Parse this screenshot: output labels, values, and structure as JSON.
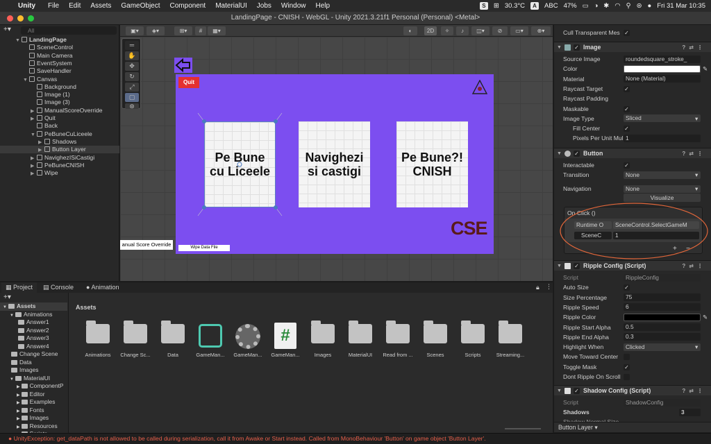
{
  "menubar": {
    "app": "Unity",
    "items": [
      "File",
      "Edit",
      "Assets",
      "GameObject",
      "Component",
      "MaterialUI",
      "Jobs",
      "Window",
      "Help"
    ],
    "temp": "30.3°C",
    "input": "ABC",
    "battery": "47%",
    "datetime": "Fri 31 Mar  10:35"
  },
  "window": {
    "title": "LandingPage - CNISH - WebGL - Unity 2021.3.21f1 Personal (Personal) <Metal>"
  },
  "hierarchy": {
    "search_placeholder": "All",
    "items": [
      {
        "label": "LandingPage",
        "level": 0
      },
      {
        "label": "SceneControl",
        "level": 1
      },
      {
        "label": "Main Camera",
        "level": 1
      },
      {
        "label": "EventSystem",
        "level": 1
      },
      {
        "label": "SaveHandler",
        "level": 1
      },
      {
        "label": "Canvas",
        "level": 1
      },
      {
        "label": "Background",
        "level": 2
      },
      {
        "label": "Image (1)",
        "level": 2
      },
      {
        "label": "Image (3)",
        "level": 2
      },
      {
        "label": "ManualScoreOverride",
        "level": 2
      },
      {
        "label": "Quit",
        "level": 2
      },
      {
        "label": "Back",
        "level": 2
      },
      {
        "label": "PeBuneCuLiceele",
        "level": 2
      },
      {
        "label": "Shadows",
        "level": 3
      },
      {
        "label": "Button Layer",
        "level": 3
      },
      {
        "label": "NavighezISiCastigi",
        "level": 2
      },
      {
        "label": "PeBuneCNISH",
        "level": 2
      },
      {
        "label": "Wipe",
        "level": 2
      }
    ]
  },
  "scene": {
    "mode_2d": "2D",
    "quit_label": "Quit",
    "cards": [
      "Pe Bune\ncu Liceele",
      "Navighezi\nsi castigi",
      "Pe Bune?!\nCNISH"
    ],
    "wipe_label": "Wipe Data File",
    "manual_label": "anual Score Override",
    "logo_text": "CSE"
  },
  "inspector": {
    "cull": "Cull Transparent Mes",
    "image_header": "Image",
    "image_fields": [
      {
        "label": "Source Image",
        "value": "roundedsquare_stroke_"
      },
      {
        "label": "Color",
        "value": ""
      },
      {
        "label": "Material",
        "value": "None (Material)"
      },
      {
        "label": "Raycast Target",
        "value": "✓"
      },
      {
        "label": "Raycast Padding",
        "value": ""
      },
      {
        "label": "Maskable",
        "value": "✓"
      },
      {
        "label": "Image Type",
        "value": "Sliced"
      },
      {
        "label": "Fill Center",
        "value": "✓"
      },
      {
        "label": "Pixels Per Unit Mul",
        "value": "1"
      }
    ],
    "button_header": "Button",
    "button_fields": [
      {
        "label": "Interactable",
        "value": "✓"
      },
      {
        "label": "Transition",
        "value": "None"
      },
      {
        "label": "Navigation",
        "value": "None"
      }
    ],
    "visualize": "Visualize",
    "onclick_title": "On Click ()",
    "onclick_runtime": "Runtime O",
    "onclick_method": "SceneControl.SelectGameM",
    "onclick_obj": "SceneC",
    "onclick_arg": "1",
    "ripple_header": "Ripple Config (Script)",
    "ripple_fields": [
      {
        "label": "Script",
        "value": "RippleConfig"
      },
      {
        "label": "Auto Size",
        "value": "✓"
      },
      {
        "label": "Size Percentage",
        "value": "75"
      },
      {
        "label": "Ripple Speed",
        "value": "6"
      },
      {
        "label": "Ripple Color",
        "value": ""
      },
      {
        "label": "Ripple Start Alpha",
        "value": "0.5"
      },
      {
        "label": "Ripple End Alpha",
        "value": "0.3"
      },
      {
        "label": "Highlight When",
        "value": "Clicked"
      },
      {
        "label": "Move Toward Center",
        "value": ""
      },
      {
        "label": "Toggle Mask",
        "value": "✓"
      },
      {
        "label": "Dont Ripple On Scroll",
        "value": ""
      }
    ],
    "shadow_header": "Shadow Config (Script)",
    "shadow_script": "ShadowConfig",
    "shadows_label": "Shadows",
    "shadows_value": "3",
    "shadow_normal": "Shadow Normal Size",
    "footer": "Button Layer"
  },
  "project": {
    "tabs": [
      "Project",
      "Console",
      "Animation"
    ],
    "breadcrumb": "Assets",
    "badge": "8",
    "tree": [
      {
        "label": "Assets",
        "level": 0
      },
      {
        "label": "Animations",
        "level": 1
      },
      {
        "label": "Answer1",
        "level": 2
      },
      {
        "label": "Answer2",
        "level": 2
      },
      {
        "label": "Answer3",
        "level": 2
      },
      {
        "label": "Answer4",
        "level": 2
      },
      {
        "label": "Change Scene",
        "level": 1
      },
      {
        "label": "Data",
        "level": 1
      },
      {
        "label": "Images",
        "level": 1
      },
      {
        "label": "MaterialUI",
        "level": 1
      },
      {
        "label": "ComponentP",
        "level": 2
      },
      {
        "label": "Editor",
        "level": 2
      },
      {
        "label": "Examples",
        "level": 2
      },
      {
        "label": "Fonts",
        "level": 2
      },
      {
        "label": "Images",
        "level": 2
      },
      {
        "label": "Resources",
        "level": 2
      },
      {
        "label": "Scripts",
        "level": 2
      }
    ],
    "assets": [
      "Animations",
      "Change Sc...",
      "Data",
      "GameMan...",
      "GameMan...",
      "GameMan...",
      "Images",
      "MaterialUI",
      "Read from ...",
      "Scenes",
      "Scripts",
      "Streaming..."
    ]
  },
  "status": "UnityException: get_dataPath is not allowed to be called during serialization, call it from Awake or Start instead. Called from MonoBehaviour 'Button' on game object 'Button Layer'."
}
